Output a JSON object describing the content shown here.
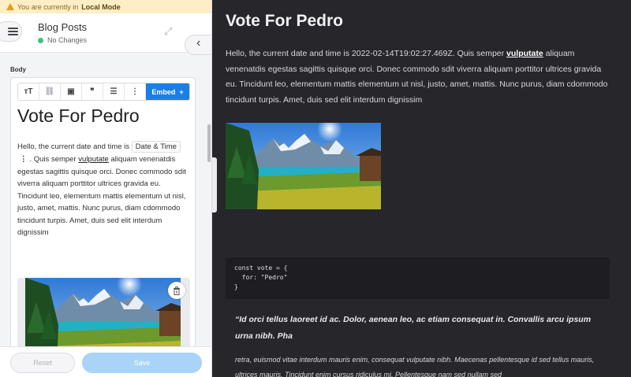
{
  "banner": {
    "prefix": "You are currently in",
    "mode": "Local Mode"
  },
  "header": {
    "title": "Blog Posts",
    "status": "No Changes"
  },
  "editor": {
    "field_label": "Body",
    "toolbar": {
      "heading": "тT",
      "link": "⛓",
      "image": "▣",
      "quote": "❞",
      "list": "☰",
      "more": "⋮",
      "embed_label": "Embed",
      "embed_plus": "+"
    },
    "heading": "Vote For Pedro",
    "para_start": "Hello, the current date and time is",
    "chip": "Date & Time",
    "chip_menu": "⋮",
    "para_mid": ". Quis semper",
    "link": "vulputate",
    "para_end": "aliquam venenatdis egestas sagittis quisque orci. Donec commodo sdit viverra aliquam porttitor ultrices gravida eu. Tincidunt leo, elementum mattis elementum ut nisl, justo, amet, mattis. Nunc purus, diam cdommodo tincidunt turpis. Amet, duis sed elit interdum dignissim"
  },
  "footer": {
    "reset": "Reset",
    "save": "Save"
  },
  "preview": {
    "heading": "Vote For Pedro",
    "para_start": "Hello, the current date and time is 2022-02-14T19:02:27.469Z. Quis semper",
    "link": "vulputate",
    "para_end": "aliquam venenatdis egestas sagittis quisque orci. Donec commodo sdit viverra aliquam porttitor ultrices gravida eu. Tincidunt leo, elementum mattis elementum ut nisl, justo, amet, mattis. Nunc purus, diam cdommodo tincidunt turpis. Amet, duis sed elit interdum dignissim",
    "code": "const vote = {\n  for: \"Pedro\"\n}",
    "quote": "“Id orci tellus laoreet id ac. Dolor, aenean leo, ac etiam consequat in. Convallis arcu ipsum urna nibh. Pha",
    "para2": "retra, euismod vitae interdum mauris enim, consequat vulputate nibh. Maecenas pellentesque id sed tellus mauris, ultrices mauris. Tincidunt enim cursus ridiculus mi. Pellentesque nam sed nullam sed"
  },
  "icons": {
    "menu": "hamburger-menu-icon",
    "expand": "expand-arrows-icon",
    "back": "chevron-left-icon",
    "warning": "warning-triangle-icon",
    "trash": "trash-icon"
  },
  "colors": {
    "accent": "#1a7fe5",
    "save_disabled": "#a9d3f7",
    "status_ok": "#3cc27a",
    "preview_bg": "#26262b"
  }
}
